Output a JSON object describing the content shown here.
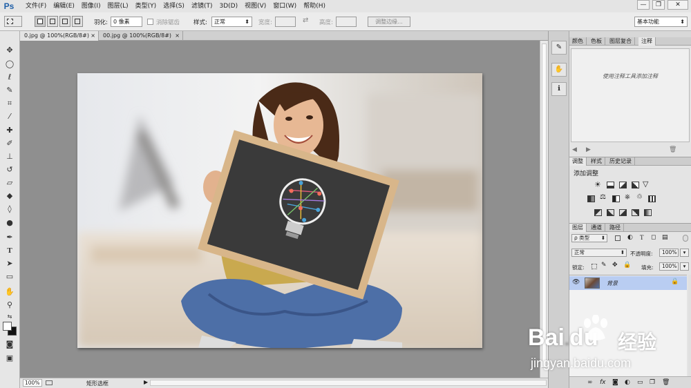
{
  "app": {
    "logo": "Ps"
  },
  "menu": [
    "文件(F)",
    "编辑(E)",
    "图像(I)",
    "图层(L)",
    "类型(Y)",
    "选择(S)",
    "滤镜(T)",
    "3D(D)",
    "视图(V)",
    "窗口(W)",
    "帮助(H)"
  ],
  "window_controls": {
    "minimize": "—",
    "restore": "❐",
    "close": "✕"
  },
  "options": {
    "feather_label": "羽化:",
    "feather_value": "0 像素",
    "antialias_label": "消除锯齿",
    "style_label": "样式:",
    "style_value": "正常",
    "width_label": "宽度:",
    "height_label": "高度:",
    "refine_edge_label": "调整边缘...",
    "workspace_value": "基本功能"
  },
  "document_tabs": [
    {
      "label": "0.jpg @ 100%(RGB/8#)",
      "close": "×"
    },
    {
      "label": "00.jpg @ 100%(RGB/8#)",
      "close": "×"
    }
  ],
  "status": {
    "zoom": "100%",
    "tool": "矩形选框",
    "arrow": "▶"
  },
  "panels": {
    "top_tabs": [
      "颜色",
      "色板",
      "图层复合",
      "注释"
    ],
    "notes_placeholder": "使用注释工具添加注释",
    "adjust_tabs": [
      "调整",
      "样式",
      "历史记录"
    ],
    "add_adjustment": "添加调整",
    "layers_tabs": [
      "图层",
      "通道",
      "路径"
    ],
    "kind_filter": "ρ 类型",
    "blend_mode": "正常",
    "opacity_label": "不透明度:",
    "opacity_value": "100%",
    "lock_label": "锁定:",
    "fill_label": "填充:",
    "fill_value": "100%",
    "layer_name": "背景"
  },
  "watermark": {
    "brand": "Bai",
    "brand2": "du",
    "cn": "经验",
    "url": "jingyan.baidu.com"
  },
  "colors": {
    "accent": "#1f5fa8",
    "selected_layer": "#b9cdf2",
    "canvas_bg": "#8f8f8f"
  }
}
